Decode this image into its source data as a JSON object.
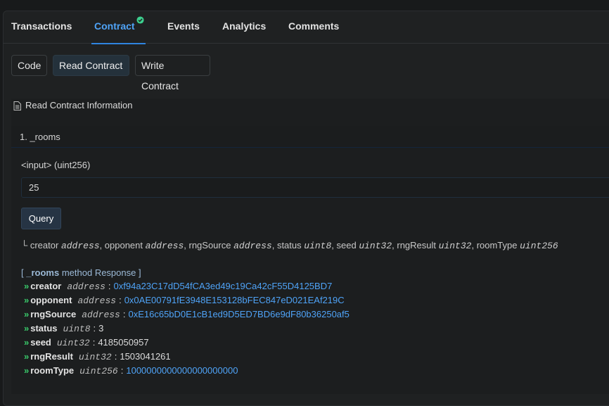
{
  "tabs": [
    {
      "label": "Transactions"
    },
    {
      "label": "Contract"
    },
    {
      "label": "Events"
    },
    {
      "label": "Analytics"
    },
    {
      "label": "Comments"
    }
  ],
  "subtabs": [
    {
      "label": "Code"
    },
    {
      "label": "Read Contract"
    },
    {
      "label": "Write Contract"
    }
  ],
  "info_title": "Read Contract Information",
  "method": {
    "header": "1. _rooms",
    "input_label": "<input> (uint256)",
    "input_value": "25",
    "query_label": "Query",
    "signature_prefix": "└",
    "signature": [
      {
        "name": "creator",
        "type": "address"
      },
      {
        "name": "opponent",
        "type": "address"
      },
      {
        "name": "rngSource",
        "type": "address"
      },
      {
        "name": "status",
        "type": "uint8"
      },
      {
        "name": "seed",
        "type": "uint32"
      },
      {
        "name": "rngResult",
        "type": "uint32"
      },
      {
        "name": "roomType",
        "type": "uint256"
      }
    ],
    "response_open": "[",
    "response_method": "_rooms",
    "response_suffix": "method Response ]",
    "response": [
      {
        "name": "creator",
        "type": "address",
        "value": "0xf94a23C17dD54fCA3ed49c19Ca42cF55D4125BD7"
      },
      {
        "name": "opponent",
        "type": "address",
        "value": "0x0AE00791fE3948E153128bFEC847eD021EAf219C"
      },
      {
        "name": "rngSource",
        "type": "address",
        "value": "0xE16c65bD0E1cB1ed9D5ED7BD6e9dF80b36250af5"
      },
      {
        "name": "status",
        "type": "uint8",
        "value": "3"
      },
      {
        "name": "seed",
        "type": "uint32",
        "value": "4185050957"
      },
      {
        "name": "rngResult",
        "type": "uint32",
        "value": "1503041261"
      },
      {
        "name": "roomType",
        "type": "uint256",
        "value": "1000000000000000000000"
      }
    ]
  },
  "colors": {
    "accent": "#4fa3f7",
    "arrow": "#39c96a",
    "verified": "#3ccf8e"
  }
}
